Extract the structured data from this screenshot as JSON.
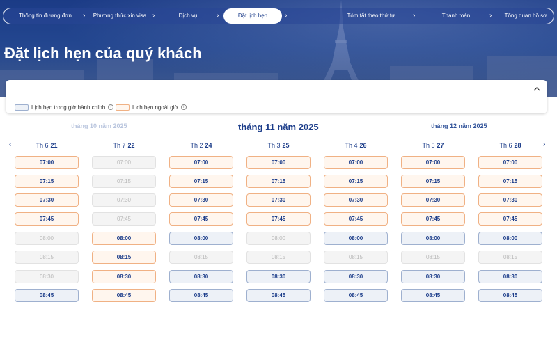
{
  "stepper": {
    "steps": [
      {
        "label": "Thông tin đương đơn",
        "active": false
      },
      {
        "label": "Phương thức xin visa",
        "active": false
      },
      {
        "label": "Dịch vụ",
        "active": false
      },
      {
        "label": "Đặt lịch hẹn",
        "active": true
      },
      {
        "label": "Tóm tắt theo thứ tự",
        "active": false
      },
      {
        "label": "Thanh toán",
        "active": false
      },
      {
        "label": "Tổng quan hồ sơ",
        "active": false
      }
    ]
  },
  "page_title": "Đặt lịch hẹn của quý khách",
  "legend": {
    "regular_label": "Lịch hẹn trong giờ hành chính",
    "offhours_label": "Lịch hẹn ngoài giờ",
    "regular_color": "#edf1f7",
    "offhours_color": "#fff6ee"
  },
  "calendar": {
    "prev_month": "tháng 10 năm 2025",
    "current_month": "tháng 11 năm 2025",
    "next_month": "tháng 12 năm 2025",
    "days": [
      {
        "weekday": "Th 6",
        "date": "21",
        "slots": [
          {
            "time": "07:00",
            "state": "off"
          },
          {
            "time": "07:15",
            "state": "off"
          },
          {
            "time": "07:30",
            "state": "off"
          },
          {
            "time": "07:45",
            "state": "off"
          },
          {
            "time": "08:00",
            "state": "dis"
          },
          {
            "time": "08:15",
            "state": "dis"
          },
          {
            "time": "08:30",
            "state": "dis"
          },
          {
            "time": "08:45",
            "state": "reg"
          }
        ]
      },
      {
        "weekday": "Th 7",
        "date": "22",
        "slots": [
          {
            "time": "07:00",
            "state": "dis"
          },
          {
            "time": "07:15",
            "state": "dis"
          },
          {
            "time": "07:30",
            "state": "dis"
          },
          {
            "time": "07:45",
            "state": "dis"
          },
          {
            "time": "08:00",
            "state": "off"
          },
          {
            "time": "08:15",
            "state": "off"
          },
          {
            "time": "08:30",
            "state": "off"
          },
          {
            "time": "08:45",
            "state": "off"
          }
        ]
      },
      {
        "weekday": "Th 2",
        "date": "24",
        "slots": [
          {
            "time": "07:00",
            "state": "off"
          },
          {
            "time": "07:15",
            "state": "off"
          },
          {
            "time": "07:30",
            "state": "off"
          },
          {
            "time": "07:45",
            "state": "off"
          },
          {
            "time": "08:00",
            "state": "reg"
          },
          {
            "time": "08:15",
            "state": "dis"
          },
          {
            "time": "08:30",
            "state": "reg"
          },
          {
            "time": "08:45",
            "state": "reg"
          }
        ]
      },
      {
        "weekday": "Th 3",
        "date": "25",
        "slots": [
          {
            "time": "07:00",
            "state": "off"
          },
          {
            "time": "07:15",
            "state": "off"
          },
          {
            "time": "07:30",
            "state": "off"
          },
          {
            "time": "07:45",
            "state": "off"
          },
          {
            "time": "08:00",
            "state": "dis"
          },
          {
            "time": "08:15",
            "state": "dis"
          },
          {
            "time": "08:30",
            "state": "reg"
          },
          {
            "time": "08:45",
            "state": "reg"
          }
        ]
      },
      {
        "weekday": "Th 4",
        "date": "26",
        "slots": [
          {
            "time": "07:00",
            "state": "off"
          },
          {
            "time": "07:15",
            "state": "off"
          },
          {
            "time": "07:30",
            "state": "off"
          },
          {
            "time": "07:45",
            "state": "off"
          },
          {
            "time": "08:00",
            "state": "reg"
          },
          {
            "time": "08:15",
            "state": "dis"
          },
          {
            "time": "08:30",
            "state": "reg"
          },
          {
            "time": "08:45",
            "state": "reg"
          }
        ]
      },
      {
        "weekday": "Th 5",
        "date": "27",
        "slots": [
          {
            "time": "07:00",
            "state": "off"
          },
          {
            "time": "07:15",
            "state": "off"
          },
          {
            "time": "07:30",
            "state": "off"
          },
          {
            "time": "07:45",
            "state": "off"
          },
          {
            "time": "08:00",
            "state": "reg"
          },
          {
            "time": "08:15",
            "state": "dis"
          },
          {
            "time": "08:30",
            "state": "reg"
          },
          {
            "time": "08:45",
            "state": "reg"
          }
        ]
      },
      {
        "weekday": "Th 6",
        "date": "28",
        "slots": [
          {
            "time": "07:00",
            "state": "off"
          },
          {
            "time": "07:15",
            "state": "off"
          },
          {
            "time": "07:30",
            "state": "off"
          },
          {
            "time": "07:45",
            "state": "off"
          },
          {
            "time": "08:00",
            "state": "reg"
          },
          {
            "time": "08:15",
            "state": "dis"
          },
          {
            "time": "08:30",
            "state": "reg"
          },
          {
            "time": "08:45",
            "state": "reg"
          }
        ]
      }
    ]
  },
  "icons": {
    "prev": "chevron-left-icon",
    "next": "chevron-right-icon",
    "collapse": "chevron-up-icon",
    "info": "info-icon"
  }
}
